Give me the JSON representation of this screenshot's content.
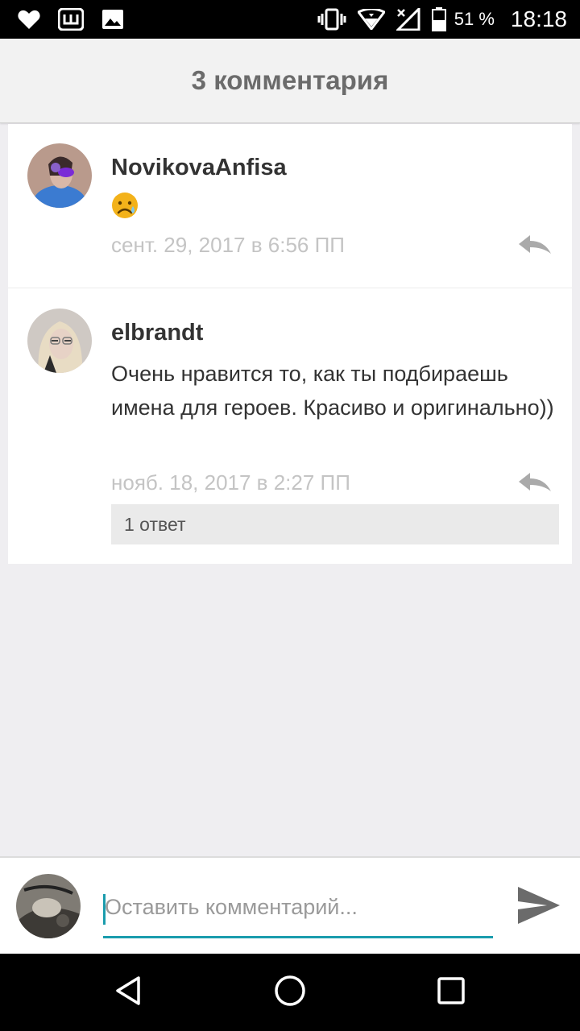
{
  "status_bar": {
    "battery_percent": "51 %",
    "time": "18:18",
    "icons": [
      "heart-icon",
      "app-shortcut-icon",
      "gallery-icon",
      "vibrate-icon",
      "wifi-icon",
      "no-signal-icon",
      "battery-icon"
    ]
  },
  "header": {
    "title": "3 комментария"
  },
  "comments": [
    {
      "author": "NovikovaAnfisa",
      "text": "",
      "emoji": "frowning-face",
      "timestamp": "сент. 29, 2017 в 6:56 ПП"
    },
    {
      "author": "elbrandt",
      "text": "Очень нравится то, как ты подбираешь имена для героев. Красиво и оригинально))",
      "timestamp": "нояб. 18, 2017 в 2:27 ПП",
      "replies_label": "1 ответ"
    }
  ],
  "composer": {
    "placeholder": "Оставить комментарий...",
    "value": ""
  },
  "colors": {
    "accent": "#1a9cad",
    "background": "#efeef1",
    "header_text": "#6b6b6b",
    "timestamp": "#c4c4c4"
  }
}
